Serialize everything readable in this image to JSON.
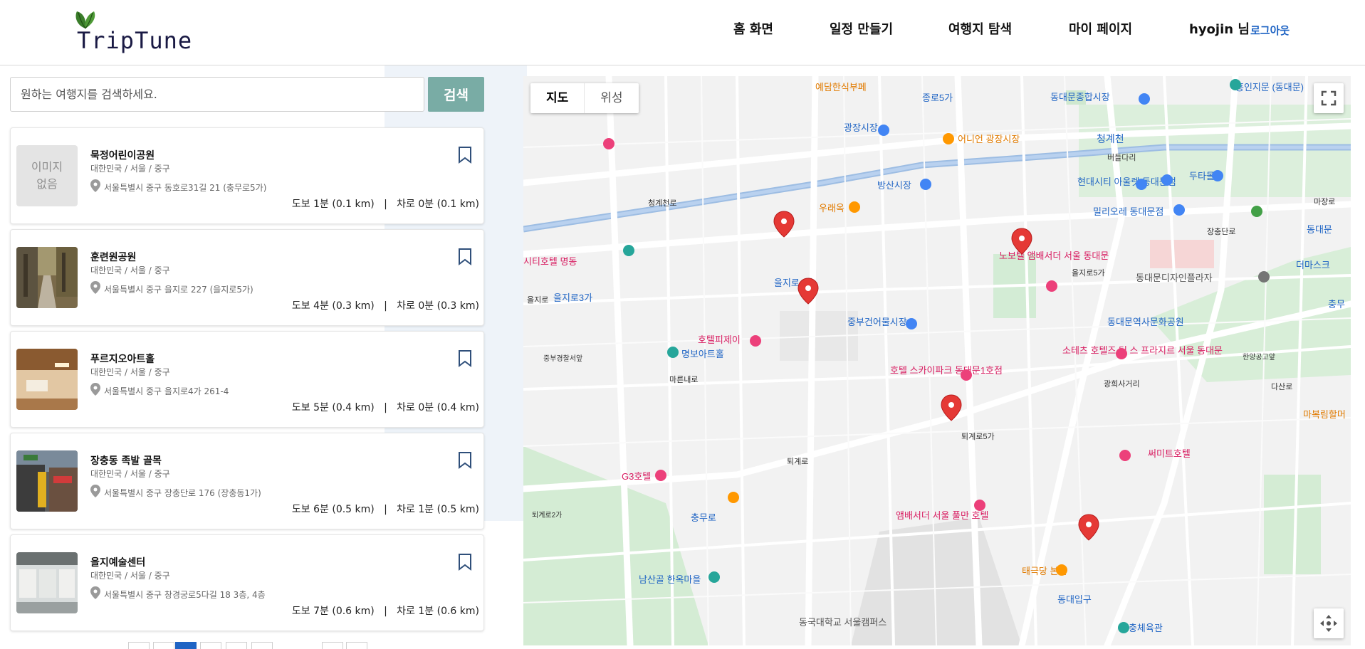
{
  "header": {
    "logo_text": "TripTune",
    "nav": [
      {
        "label": "홈 화면"
      },
      {
        "label": "일정 만들기"
      },
      {
        "label": "여행지 탐색"
      },
      {
        "label": "마이 페이지"
      }
    ],
    "user_name": "hyojin 님",
    "logout_label": "로그아웃"
  },
  "search": {
    "placeholder": "원하는 여행지를 검색하세요.",
    "button_label": "검색"
  },
  "places": [
    {
      "title": "묵정어린이공원",
      "region": "대한민국 / 서울 / 중구",
      "address": "서울특별시 중구 동호로31길 21 (충무로5가)",
      "distance": "도보 1분 (0.1 km)   |   차로 0분 (0.1 km)",
      "image": "none",
      "image_placeholder": "이미지\n없음"
    },
    {
      "title": "훈련원공원",
      "region": "대한민국 / 서울 / 중구",
      "address": "서울특별시 중구 을지로 227 (을지로5가)",
      "distance": "도보 4분 (0.3 km)   |   차로 0분 (0.3 km)",
      "image": "park"
    },
    {
      "title": "푸르지오아트홀",
      "region": "대한민국 / 서울 / 중구",
      "address": "서울특별시 중구 을지로4가 261-4",
      "distance": "도보 5분 (0.4 km)   |   차로 0분 (0.4 km)",
      "image": "hall"
    },
    {
      "title": "장충동 족발 골목",
      "region": "대한민국 / 서울 / 중구",
      "address": "서울특별시 중구 장충단로 176 (장충동1가)",
      "distance": "도보 6분 (0.5 km)   |   차로 1분 (0.5 km)",
      "image": "street"
    },
    {
      "title": "을지예술센터",
      "region": "대한민국 / 서울 / 중구",
      "address": "서울특별시 중구 창경궁로5다길 18 3층, 4층",
      "distance": "도보 7분 (0.6 km)   |   차로 1분 (0.6 km)",
      "image": "gallery"
    }
  ],
  "map": {
    "type_map": "지도",
    "type_satellite": "위성",
    "labels": {
      "l1": "예담한식부페",
      "l2": "종로5가",
      "l3": "동대문종합시장",
      "l4": "흥인지문 (동대문)",
      "l5": "광장시장",
      "l6": "어니언 광장시장",
      "l7": "청계천",
      "l8": "버들다리",
      "l9": "방산시장",
      "l10": "우래옥",
      "l11": "현대시티 아울렛 동대문점",
      "l12": "두타몰",
      "l13": "밀리오레 동대문점",
      "l14": "노보텔 앰배서더 서울 동대문",
      "l15": "동대문디자인플라자",
      "l16": "을지로3가",
      "l17": "을지로4가",
      "l18": "을지로5가",
      "l19": "중부건어물시장",
      "l20": "동대문역사문화공원",
      "l21": "호텔피제이",
      "l22": "명보아트홀",
      "l23": "소테츠 호텔즈 더 스 프라지르 서울 동대문",
      "l24": "호텔 스카이파크 동대문1호점",
      "l25": "광희사거리",
      "l26": "퇴계로5가",
      "l27": "써미트호텔",
      "l28": "G3호텔",
      "l29": "충무로",
      "l30": "앰배서더 서울 풀만 호텔",
      "l31": "태극당 본점",
      "l32": "남산골 한옥마을",
      "l33": "동대입구",
      "l34": "장충체육관",
      "l35": "동국대학교 서울캠퍼스",
      "l36": "시티호텔 명동",
      "l37": "청계천로",
      "l38": "퇴계로",
      "l39": "마장로",
      "l40": "장충단로",
      "l41": "한양공고앞",
      "l42": "중부경찰서앞",
      "l43": "퇴계로2가",
      "l44": "을지로",
      "l45": "마른내로",
      "l46": "다산로",
      "l47": "동대문",
      "l48": "더마스크",
      "l49": "충무",
      "l50": "마복림할머"
    }
  },
  "colors": {
    "accent": "#79aca5",
    "marker": "#e53935",
    "link": "#1f64c4"
  }
}
